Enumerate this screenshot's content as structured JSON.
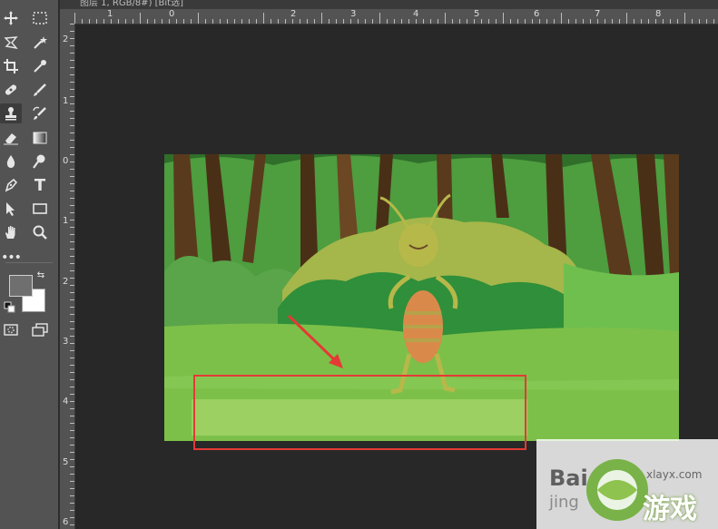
{
  "document_tab": {
    "title": "图层 1, RGB/8#) [Bit选]"
  },
  "toolbar": {
    "tools": [
      {
        "name": "move-tool",
        "glyph": "✥"
      },
      {
        "name": "marquee-tool",
        "glyph": "⬚"
      },
      {
        "name": "lasso-tool",
        "glyph": "ᔑ"
      },
      {
        "name": "magic-wand-tool",
        "glyph": "✶"
      },
      {
        "name": "crop-tool",
        "glyph": "⌗"
      },
      {
        "name": "eyedropper-tool",
        "glyph": "✎"
      },
      {
        "name": "healing-tool",
        "glyph": "✚"
      },
      {
        "name": "brush-tool",
        "glyph": "✐"
      },
      {
        "name": "clone-stamp-tool",
        "glyph": "♜"
      },
      {
        "name": "history-brush-tool",
        "glyph": "✑"
      },
      {
        "name": "eraser-tool",
        "glyph": "⌫"
      },
      {
        "name": "gradient-tool",
        "glyph": "▨"
      },
      {
        "name": "blur-tool",
        "glyph": "💧"
      },
      {
        "name": "dodge-tool",
        "glyph": "⚲"
      },
      {
        "name": "pen-tool",
        "glyph": "✒"
      },
      {
        "name": "type-tool",
        "glyph": "T"
      },
      {
        "name": "path-selection-tool",
        "glyph": "➤"
      },
      {
        "name": "rectangle-tool",
        "glyph": "▭"
      },
      {
        "name": "hand-tool",
        "glyph": "✋"
      },
      {
        "name": "zoom-tool",
        "glyph": "⚲"
      },
      {
        "name": "more-tools",
        "glyph": "•••"
      }
    ],
    "colors": {
      "foreground": "#6f6f6f",
      "background": "#ffffff"
    }
  },
  "rulers": {
    "top_labels": [
      "1",
      "0",
      "1",
      "2",
      "3",
      "4",
      "5",
      "6",
      "7",
      "8"
    ],
    "left_labels": [
      "2",
      "1",
      "0",
      "1",
      "2",
      "3",
      "4",
      "5",
      "6"
    ]
  },
  "watermark": {
    "text1": "Bai",
    "text2": "jing",
    "url": "xlayx.com",
    "logo_text": "游戏"
  },
  "accent": {
    "highlight": "#e53935"
  }
}
